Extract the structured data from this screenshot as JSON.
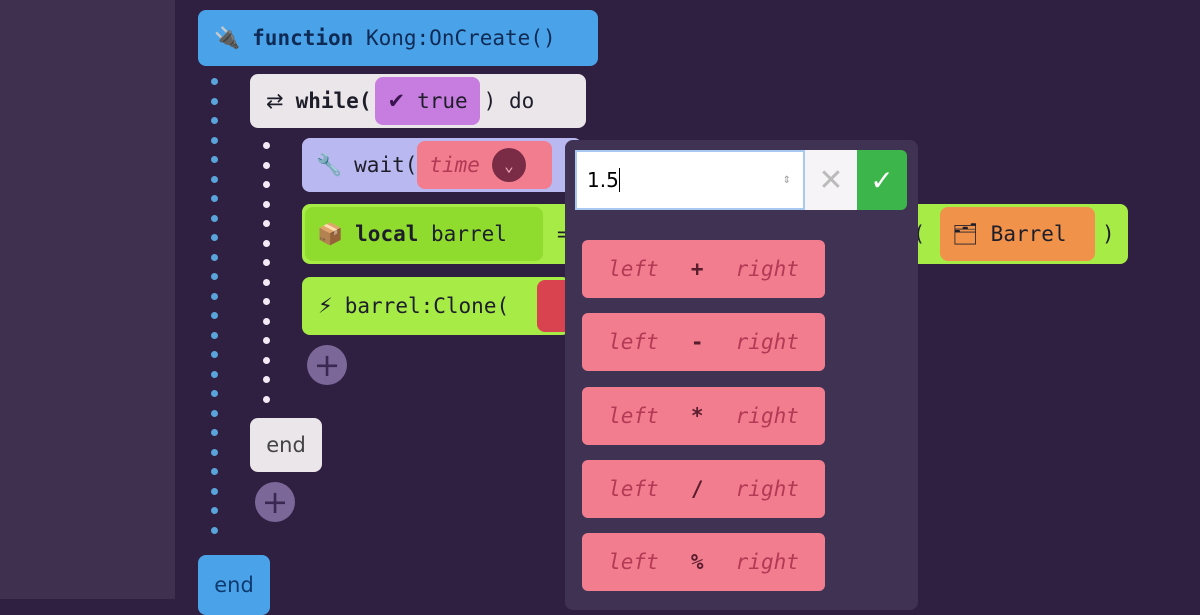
{
  "function_block": {
    "keyword": "function",
    "name": "Kong:OnCreate()",
    "icon": "plug-icon",
    "color": "#4aa3e8"
  },
  "while_block": {
    "keyword": "while(",
    "condition": "true",
    "suffix": ") do",
    "icon": "loop-icon",
    "color": "#ebe6ea"
  },
  "wait_block": {
    "label": "wait(",
    "param": "time",
    "icon": "wrench-icon",
    "color": "#b9b8f0"
  },
  "local_block": {
    "keyword": "local",
    "name": "barrel",
    "equals": "=",
    "call_suffix": "t(",
    "arg": "Barrel",
    "close": ")",
    "icon": "box-icon",
    "color": "#9ee83c"
  },
  "clone_block": {
    "label": "barrel:Clone(",
    "icon": "lightning-icon"
  },
  "end_inner": "end",
  "end_outer": "end",
  "popup": {
    "input_value": "1.5",
    "cancel_icon": "close-icon",
    "confirm_icon": "check-icon",
    "operators": [
      {
        "left": "left",
        "op": "+",
        "right": "right"
      },
      {
        "left": "left",
        "op": "-",
        "right": "right"
      },
      {
        "left": "left",
        "op": "*",
        "right": "right"
      },
      {
        "left": "left",
        "op": "/",
        "right": "right"
      },
      {
        "left": "left",
        "op": "%",
        "right": "right"
      }
    ]
  }
}
